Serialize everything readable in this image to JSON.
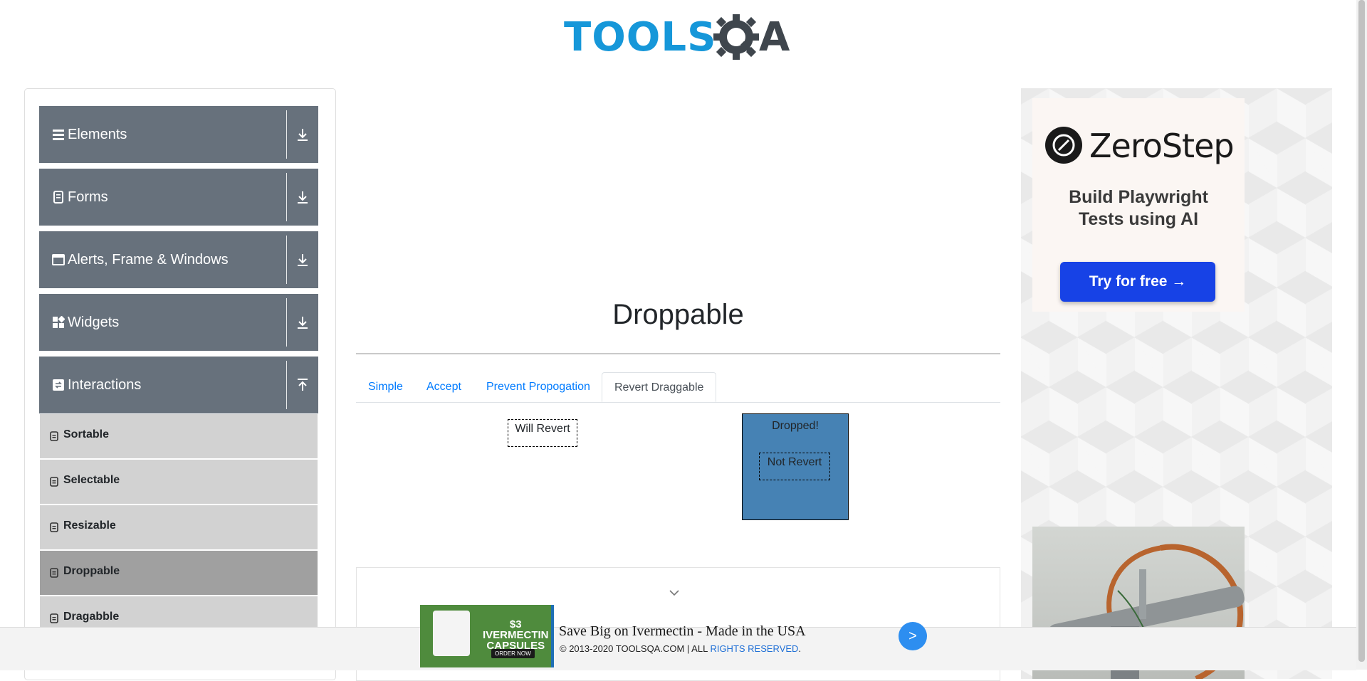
{
  "header": {
    "logo_text": "TOOLS",
    "logo_last_letter": "A"
  },
  "sidebar": {
    "groups": [
      {
        "label": "Elements",
        "icon": "hamburger-icon"
      },
      {
        "label": "Forms",
        "icon": "form-icon"
      },
      {
        "label": "Alerts, Frame & Windows",
        "icon": "window-icon"
      },
      {
        "label": "Widgets",
        "icon": "widgets-icon"
      },
      {
        "label": "Interactions",
        "icon": "interactions-icon",
        "expanded": true
      }
    ],
    "interaction_items": [
      {
        "label": "Sortable"
      },
      {
        "label": "Selectable"
      },
      {
        "label": "Resizable"
      },
      {
        "label": "Droppable",
        "active": true
      },
      {
        "label": "Dragabble"
      }
    ]
  },
  "main": {
    "title": "Droppable",
    "tabs": [
      {
        "label": "Simple"
      },
      {
        "label": "Accept"
      },
      {
        "label": "Prevent Propogation"
      },
      {
        "label": "Revert Draggable",
        "active": true
      }
    ],
    "revert_draggable": {
      "will_revert_label": "Will Revert",
      "drop_target_label": "Dropped!",
      "not_revert_label": "Not Revert"
    }
  },
  "right_ad": {
    "brand": "ZeroStep",
    "tagline_line1": "Build Playwright",
    "tagline_line2": "Tests using AI",
    "cta": "Try for free →"
  },
  "bottom_ad": {
    "price_line1": "$3",
    "price_line2": "IVERMECTIN",
    "price_line3": "CAPSULES",
    "order_label": "ORDER NOW",
    "headline": "Save Big on Ivermectin - Made in the USA",
    "go_label": ">"
  },
  "footer": {
    "copyright_prefix": "© 2013-2020 TOOLSQA.COM | ALL ",
    "copyright_highlight": "RIGHTS RESERVED",
    "copyright_suffix": "."
  },
  "colors": {
    "accent": "#007bff",
    "sidebar_header": "#67717c",
    "sidebar_item": "#d2d2d2",
    "sidebar_item_active": "#a0a0a0",
    "drop_target": "#4682b4",
    "logo_blue": "#1697d9",
    "zerostep_button": "#1742e6"
  }
}
